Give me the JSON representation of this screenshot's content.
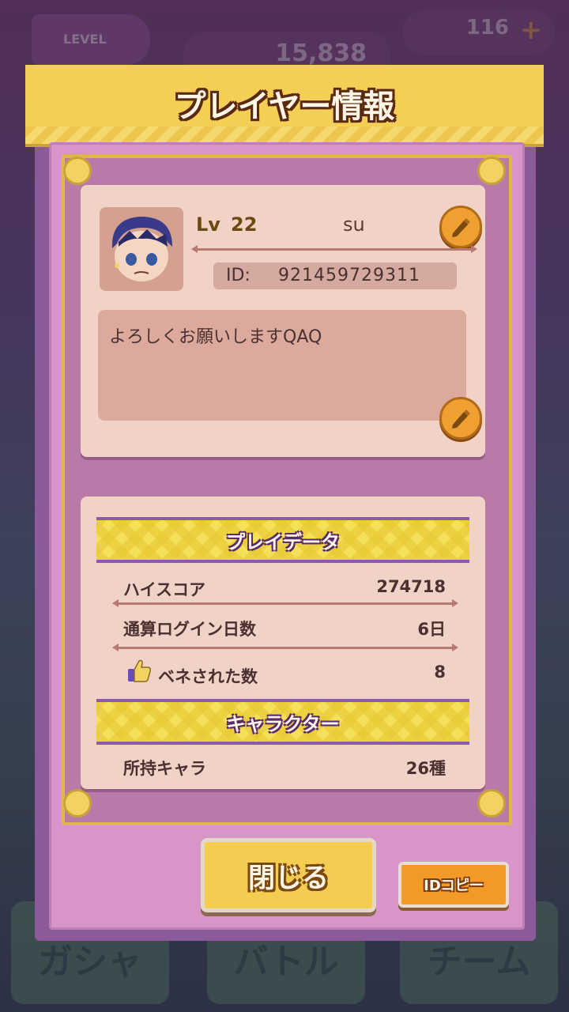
{
  "background": {
    "level_badge": "LEVEL",
    "coins": "15,838",
    "gems": "116",
    "bottom_tabs": [
      "ガシャ",
      "バトル",
      "チーム"
    ]
  },
  "dialog": {
    "title": "プレイヤー情報",
    "profile": {
      "lv_label": "Lv",
      "level": "22",
      "name": "su",
      "id_label": "ID:",
      "id_value": "921459729311",
      "comment": "よろしくお願いしますQAQ"
    },
    "play_data": {
      "header": "プレイデータ",
      "rows": [
        {
          "label": "ハイスコア",
          "value": "274718"
        },
        {
          "label": "通算ログイン日数",
          "value": "6日"
        },
        {
          "label": "ベネされた数",
          "value": "8"
        }
      ]
    },
    "character": {
      "header": "キャラクター",
      "rows": [
        {
          "label": "所持キャラ",
          "value": "26種"
        }
      ]
    },
    "buttons": {
      "close": "閉じる",
      "copy_id": "IDコピー"
    }
  },
  "colors": {
    "panel": "#d895c8",
    "frame": "#b87aa8",
    "card": "#f1d2c6",
    "accent_yellow": "#f3cf55",
    "button_orange": "#f29a25"
  }
}
